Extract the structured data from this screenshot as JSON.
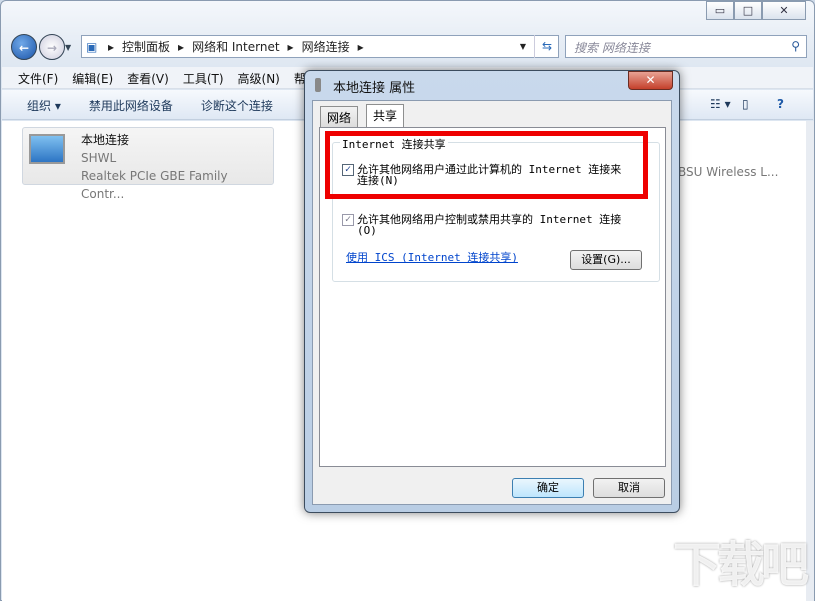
{
  "window": {
    "caption_buttons": [
      "minimize",
      "maximize",
      "close"
    ]
  },
  "address": {
    "crumbs": [
      "控制面板",
      "网络和 Internet",
      "网络连接"
    ],
    "search_placeholder": "搜索 网络连接"
  },
  "menu": [
    "文件(F)",
    "编辑(E)",
    "查看(V)",
    "工具(T)",
    "高级(N)",
    "帮"
  ],
  "toolbar": [
    "组织 ▾",
    "禁用此网络设备",
    "诊断这个连接"
  ],
  "connections": [
    {
      "name": "本地连接",
      "network": "SHWL",
      "adapter": "Realtek PCIe GBE Family Contr..."
    },
    {
      "adapter": "BSU Wireless L..."
    }
  ],
  "dialog": {
    "title": "本地连接 属性",
    "tabs": [
      "网络",
      "共享"
    ],
    "group": "Internet 连接共享",
    "check1": {
      "label": "允许其他网络用户通过此计算机的 Internet 连接来连接(N)",
      "checked": true
    },
    "check2": {
      "label": "允许其他网络用户控制或禁用共享的 Internet 连接(O)",
      "checked": true
    },
    "link": "使用 ICS (Internet 连接共享)",
    "settings": "设置(G)...",
    "ok": "确定",
    "cancel": "取消"
  },
  "highlight_color": "#ee0000",
  "watermark": "下载吧"
}
